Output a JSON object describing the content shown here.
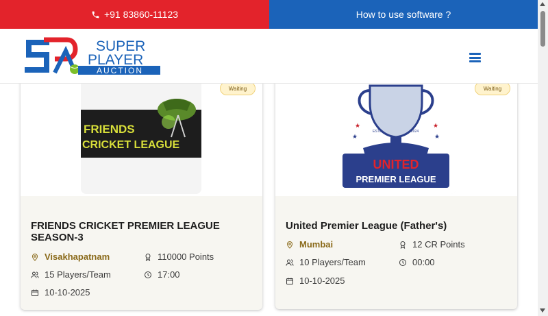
{
  "topbar": {
    "phone": "+91 83860-11123",
    "howto": "How to use software ?"
  },
  "brand": {
    "line1": "SUPER",
    "line2": "PLAYER",
    "line3": "AUCTION",
    "colors": {
      "blue": "#1b63b9",
      "red": "#e3232b",
      "green": "#7cbf2a"
    }
  },
  "cards": [
    {
      "status": "Waiting",
      "logo_line1": "FRIENDS",
      "logo_line2": "CRICKET LEAGUE",
      "title": "FRIENDS CRICKET PREMIER LEAGUE SEASON-3",
      "city": "Visakhapatnam",
      "budget": "110000 Points",
      "players": "15 Players/Team",
      "time": "17:00",
      "date": "10-10-2025"
    },
    {
      "status": "Waiting",
      "logo_estd": "ESTD",
      "logo_year": "2024",
      "logo_line1": "UNITED",
      "logo_line2": "PREMIER LEAGUE",
      "title": "United Premier League (Father's)",
      "city": "Mumbai",
      "budget": "12 CR Points",
      "players": "10 Players/Team",
      "time": "00:00",
      "date": "10-10-2025"
    }
  ]
}
